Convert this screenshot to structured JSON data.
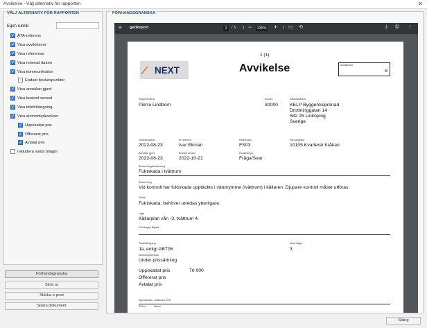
{
  "window": {
    "title": "Avvikelse - Välj alternativ för rapporten",
    "close_glyph": "✕"
  },
  "options_panel": {
    "heading": "VÄLJ ALTERNATIV FÖR RAPPORTEN",
    "custom_heading_label": "Egen rubrik:",
    "custom_heading_value": "",
    "options": [
      {
        "label": "ÄTA-referens",
        "checked": true
      },
      {
        "label": "Visa avvikelsenr",
        "checked": true
      },
      {
        "label": "Visa referensnr",
        "checked": true
      },
      {
        "label": "Visa noterad datum",
        "checked": true
      },
      {
        "label": "Visa kommunikation",
        "checked": true
      },
      {
        "label": "Endast beslutspunkter",
        "checked": false
      },
      {
        "label": "Visa anmälan gjord",
        "checked": true
      },
      {
        "label": "Visa besked senast",
        "checked": true
      },
      {
        "label": "Visa tidsförlängning",
        "checked": true
      },
      {
        "label": "Visa ekonomipåverkan",
        "checked": true
      },
      {
        "label": "Uppskattat pris",
        "checked": true
      },
      {
        "label": "Offererat pris",
        "checked": true
      },
      {
        "label": "Avtalat pris",
        "checked": true
      },
      {
        "label": "Inkludera valda bilagor",
        "checked": false
      }
    ],
    "buttons": {
      "preview": "Förhandsgranska",
      "print": "Skriv ut",
      "email": "Skicka e-post",
      "save": "Spara dokument"
    }
  },
  "preview_panel": {
    "heading": "FÖRHANDSGRANSKA",
    "viewer": {
      "filename": "getReport",
      "page_current": "1",
      "page_total": "/ 1",
      "zoom": "135%",
      "icons": [
        "menu-icon",
        "zoom-out-icon",
        "zoom-in-icon",
        "fit-page-icon",
        "rotate-icon",
        "download-icon",
        "print-icon",
        "more-icon"
      ]
    },
    "report": {
      "page_counter": "1 (1)",
      "logo_mark": "⁄",
      "logo_word": "NEXT",
      "title": "Avvikelse",
      "avvikelsenr_label": "Avvikelsenr",
      "avvikelsenr_value": "8",
      "rapporterat_av_label": "Rapporterat av",
      "rapporterat_av_value": "Pierre Lindbom",
      "kundnr_label": "Kundnr",
      "kundnr_value": "30000",
      "fakturaadress_label": "Fakturaadress",
      "fakturaadress_lines": [
        "KELP Byggentreprenad",
        "Drottninggatan 14",
        "582 25 Linköping",
        "Sverige"
      ],
      "noterad_datum_label": "Noterad datum",
      "noterad_datum_value": "2022-08-23",
      "er_referens_label": "Er referens",
      "er_referens_value": "Ivar Ekman",
      "referensnr_label": "Referensnr",
      "referensnr_value": "FS03",
      "vart_projektnr_label": "Vårt projektnr",
      "vart_projektnr_value": "10105 Kvarteret Kråkan",
      "anmalan_gjord_label": "Anmälan gjord",
      "anmalan_gjord_value": "2022-08-23",
      "besked_senast_label": "Besked senast",
      "besked_senast_value": "2022-10-21",
      "avvikelsetyp_label": "Avvikelsetyp",
      "avvikelsetyp_value": "Fråga/Svar",
      "benamning_label": "Beskrivningsbenämning",
      "benamning_value": "Fuktskada i tvättrum",
      "beskrivning_label": "Beskrivning",
      "beskrivning_value": "Vid kontroll har fuktskada upptäckts i vätutrymme (tvättrum) i källaren. Djupare kontroll måste utföras.",
      "orsak_label": "Orsak",
      "orsak_value": "Fuktskada, behöver utredas ytterligare.",
      "lage_label": "Läge",
      "lage_value": "Källarplan vån -3, tvättrum 4.",
      "foreslagen_atgard_label": "Föreslagen åtgärd",
      "tidsforlangning_label": "Tidsförlängning",
      "tidsforlangning_value": "Ja, enligt ABT06",
      "antal_dagar_label": "Antal dagar",
      "antal_dagar_value": "3",
      "ekonomipaverkan_label": "Ekonomipåverkan",
      "ekonomipaverkan_value": "Under prissättning",
      "uppskattat_pris_label": "Uppskattat pris",
      "uppskattat_pris_value": "70 000",
      "offererat_pris_label": "Offererat pris",
      "avtalat_pris_label": "Avtalat pris",
      "specifikation_label": "Specifikation, relaterade ÄTA",
      "col_ata_nr": "ÄTA nr",
      "col_namn": "Namn"
    }
  },
  "footer": {
    "close_label": "Stäng"
  }
}
